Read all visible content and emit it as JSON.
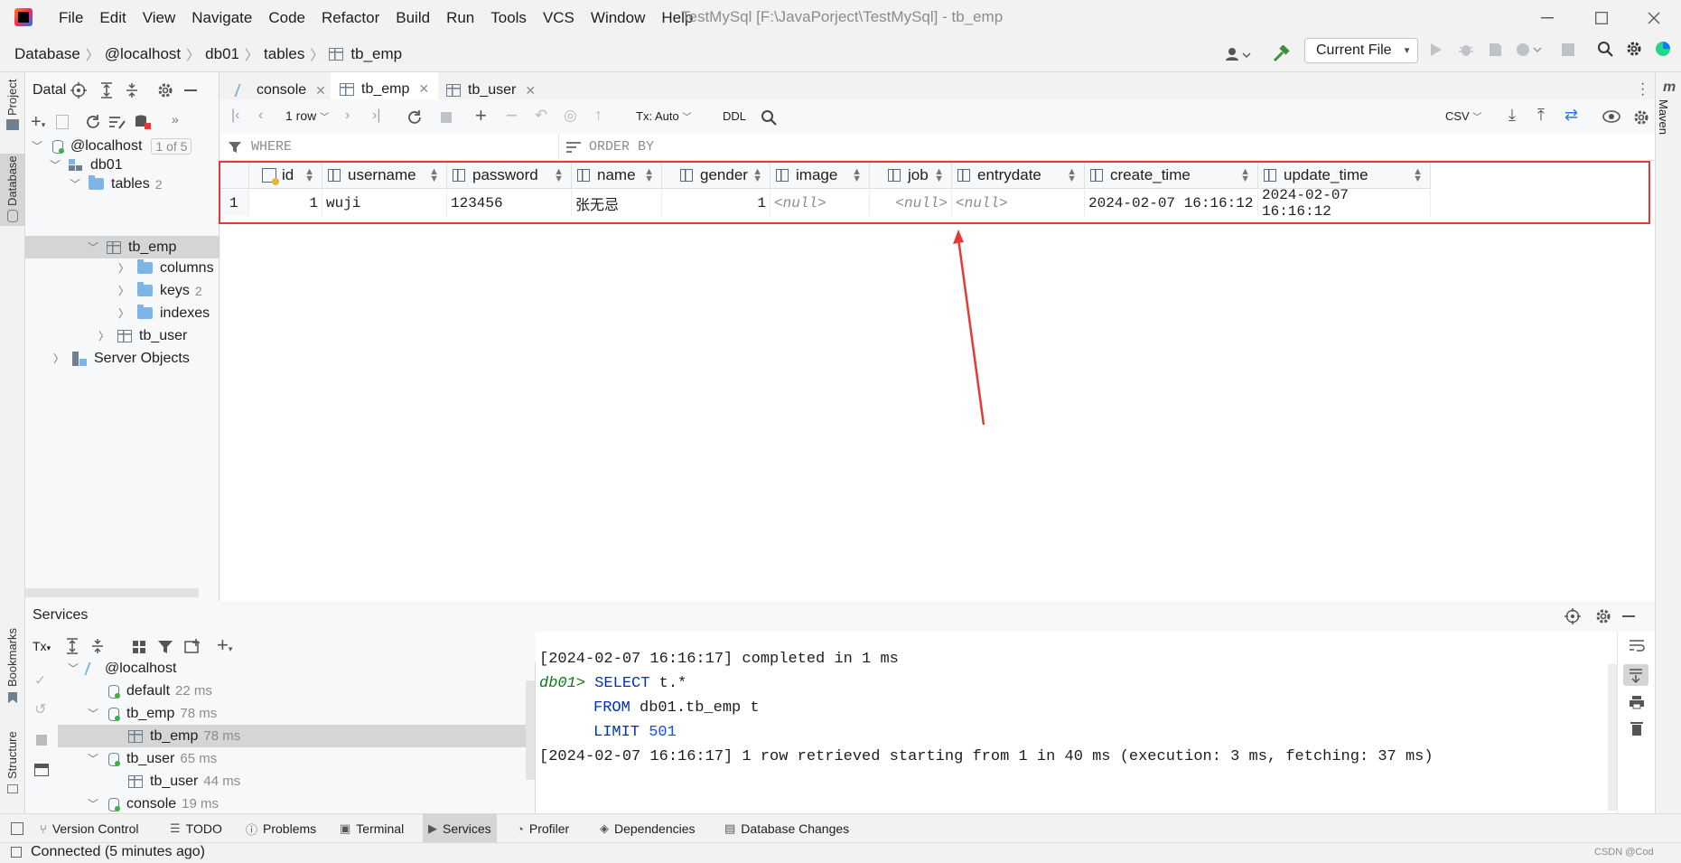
{
  "window": {
    "menu": [
      "File",
      "Edit",
      "View",
      "Navigate",
      "Code",
      "Refactor",
      "Build",
      "Run",
      "Tools",
      "VCS",
      "Window",
      "Help"
    ],
    "title": "TestMySql [F:\\JavaPorject\\TestMySql] - tb_emp"
  },
  "nav": {
    "crumbs": [
      "Database",
      "@localhost",
      "db01",
      "tables",
      "tb_emp"
    ],
    "run_config": "Current File"
  },
  "stripes": {
    "left_top": [
      "Project",
      "Database"
    ],
    "left_bottom": [
      "Bookmarks",
      "Structure"
    ],
    "right": [
      "Maven"
    ]
  },
  "db_panel": {
    "title": "Datal",
    "tree": [
      {
        "label": "@localhost",
        "badge": "1 of 5"
      },
      {
        "label": "db01"
      },
      {
        "label": "tables",
        "count": "2"
      },
      {
        "label": "tb_emp"
      },
      {
        "label": "columns"
      },
      {
        "label": "keys",
        "count": "2"
      },
      {
        "label": "indexes"
      },
      {
        "label": "tb_user"
      },
      {
        "label": "Server Objects"
      }
    ]
  },
  "editor": {
    "tabs": [
      "console",
      "tb_emp",
      "tb_user"
    ],
    "toolbar": {
      "rows": "1 row",
      "tx": "Tx: Auto",
      "ddl": "DDL",
      "export": "CSV"
    },
    "filter": {
      "where": "WHERE",
      "order_by": "ORDER BY"
    },
    "columns": [
      "id",
      "username",
      "password",
      "name",
      "gender",
      "image",
      "job",
      "entrydate",
      "create_time",
      "update_time"
    ],
    "rows": [
      {
        "num": "1",
        "cells": [
          "1",
          "wuji",
          "123456",
          "张无忌",
          "1",
          "<null>",
          "<null>",
          "<null>",
          "2024-02-07 16:16:12",
          "2024-02-07 16:16:12"
        ]
      }
    ]
  },
  "services": {
    "title": "Services",
    "tx_label": "Tx",
    "tree": [
      {
        "label": "@localhost",
        "ms": ""
      },
      {
        "label": "default",
        "ms": "22 ms"
      },
      {
        "label": "tb_emp",
        "ms": "78 ms"
      },
      {
        "label": "tb_emp",
        "ms": "78 ms"
      },
      {
        "label": "tb_user",
        "ms": "65 ms"
      },
      {
        "label": "tb_user",
        "ms": "44 ms"
      },
      {
        "label": "console",
        "ms": "19 ms"
      }
    ],
    "console": {
      "line1": "[2024-02-07 16:16:17] completed in 1 ms",
      "prompt": "db01>",
      "sql_select": "SELECT",
      "sql_select_rest": " t.*",
      "sql_from": "FROM",
      "sql_from_rest": " db01.tb_emp t",
      "sql_limit": "LIMIT",
      "sql_limit_val": "501",
      "line_result": "[2024-02-07 16:16:17] 1 row retrieved starting from 1 in 40 ms (execution: 3 ms, fetching: 37 ms)"
    }
  },
  "tool_windows": [
    "Version Control",
    "TODO",
    "Problems",
    "Terminal",
    "Services",
    "Profiler",
    "Dependencies",
    "Database Changes"
  ],
  "status": {
    "text": "Connected (5 minutes ago)",
    "watermark": "CSDN @Cod"
  },
  "colors": {
    "accent": "#3574f0",
    "annotation": "#e53935"
  }
}
